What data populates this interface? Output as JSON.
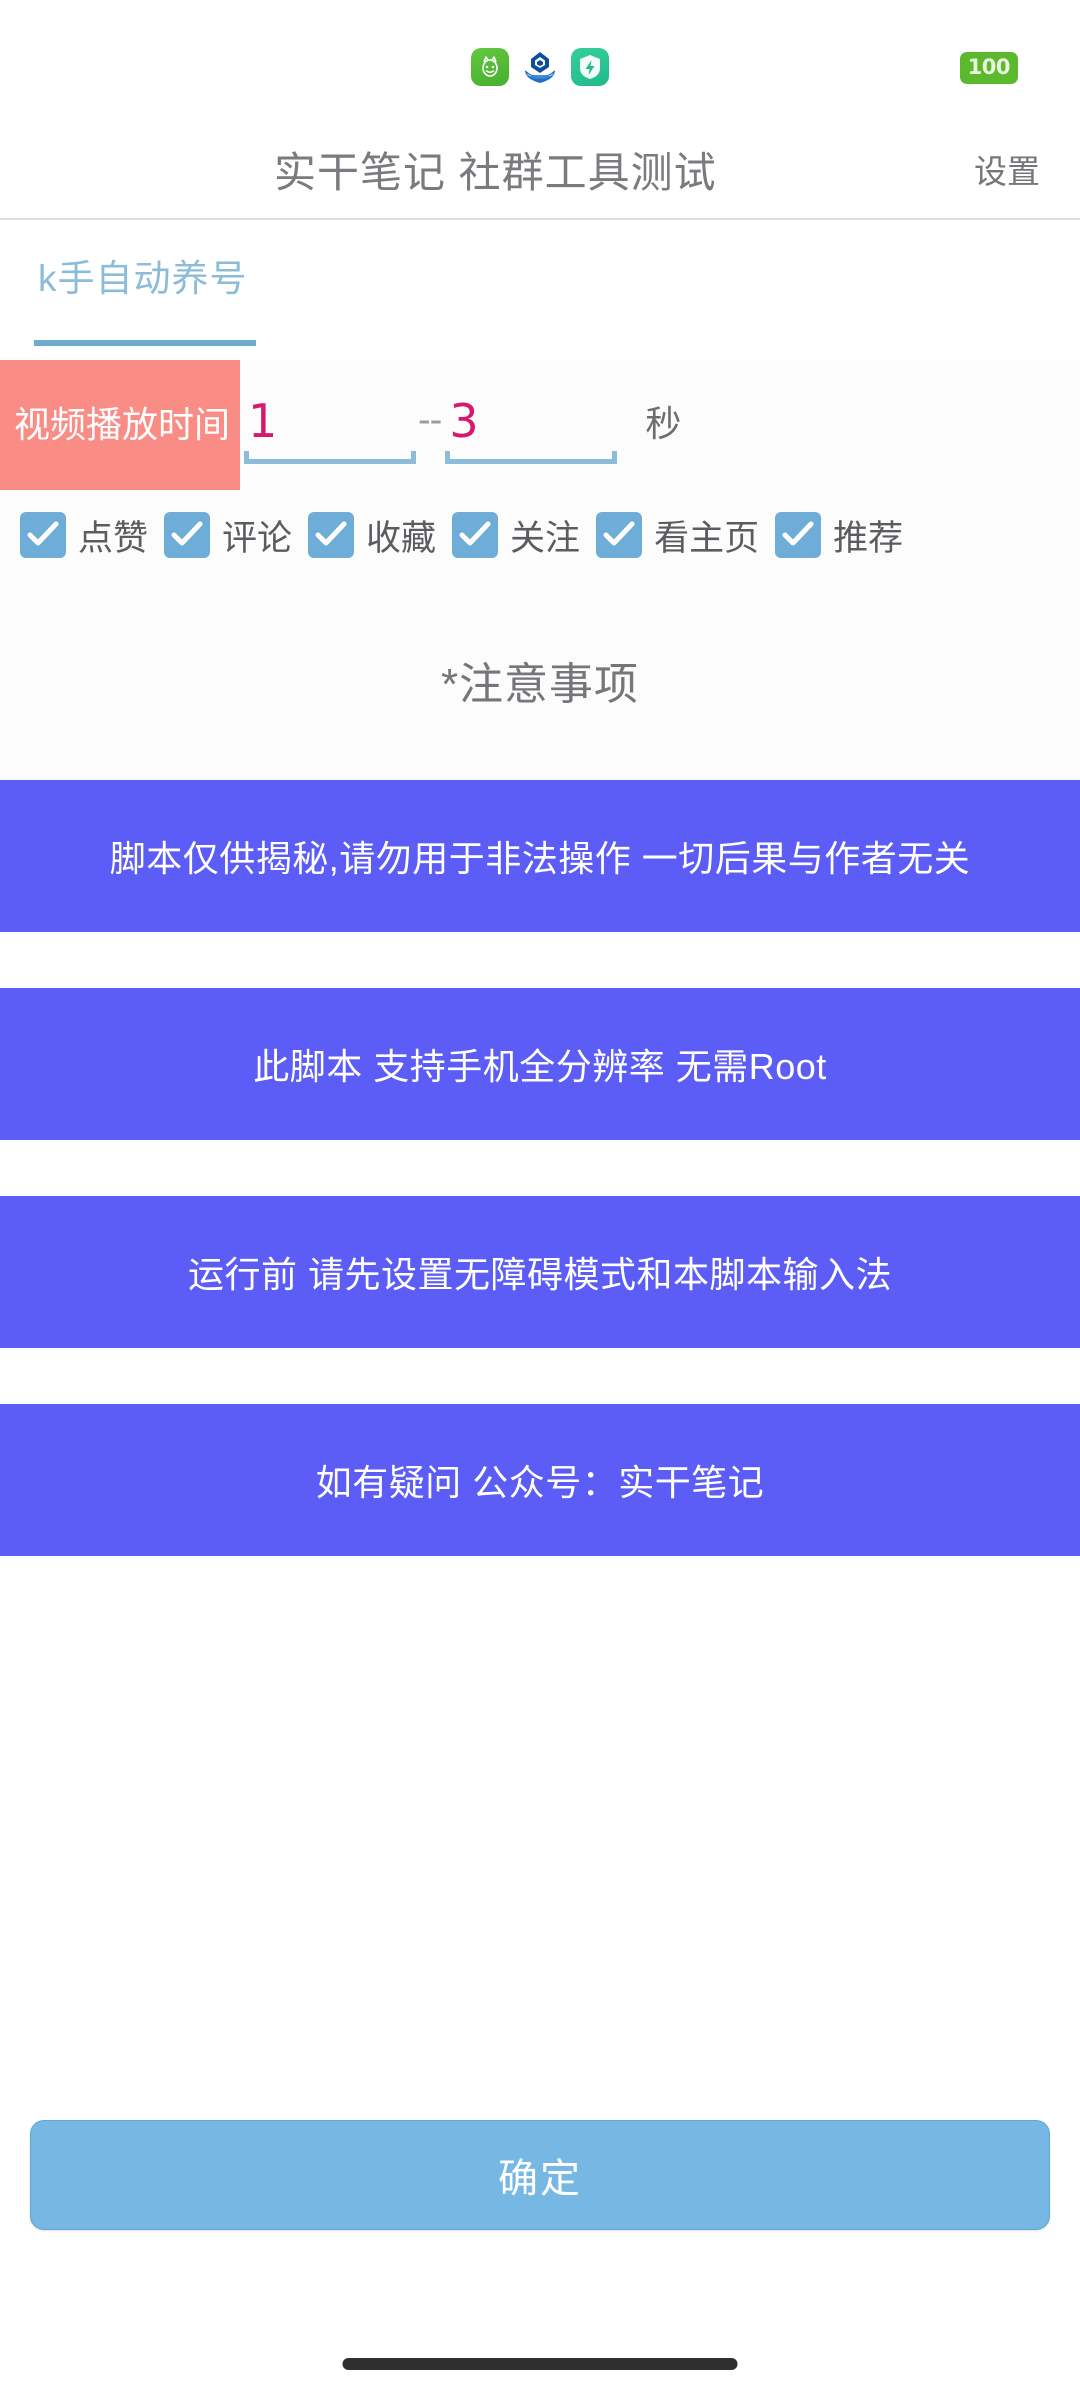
{
  "status_bar": {
    "app_icons": [
      {
        "name": "cat-face-icon",
        "color": "#55bf35"
      },
      {
        "name": "ccb-bank-icon",
        "color": "#1a5fa8"
      },
      {
        "name": "shield-bolt-icon",
        "color": "#2dc695"
      }
    ],
    "battery": {
      "label": "100",
      "bg_color": "#5cb82d",
      "text_color": "#e9f7dd"
    }
  },
  "header": {
    "title": "实干笔记 社群工具测试",
    "settings_label": "设置",
    "title_color": "#7b7b7f"
  },
  "tabs": [
    {
      "label": "k手自动养号",
      "active": true,
      "color": "#8cbcd8",
      "indicator_color": "#6fadd0"
    }
  ],
  "param_row": {
    "label": "视频播放时间",
    "label_bg": "#fa8c86",
    "min_value": "1",
    "max_value": "3",
    "separator": "--",
    "unit": "秒",
    "value_color": "#d6196e",
    "underline_color": "#8cbcd8"
  },
  "checkboxes": [
    {
      "label": "点赞",
      "checked": true
    },
    {
      "label": "评论",
      "checked": true
    },
    {
      "label": "收藏",
      "checked": true
    },
    {
      "label": "关注",
      "checked": true
    },
    {
      "label": "看主页",
      "checked": true
    },
    {
      "label": "推荐",
      "checked": true
    }
  ],
  "notice": {
    "title": "*注意事项",
    "banner_bg": "#5c5cf6",
    "items": [
      {
        "text": "脚本仅供揭秘,请勿用于非法操作 一切后果与作者无关"
      },
      {
        "text": "此脚本 支持手机全分辨率 无需Root"
      },
      {
        "text": "运行前 请先设置无障碍模式和本脚本输入法"
      },
      {
        "text": "如有疑问 公众号：实干笔记"
      }
    ]
  },
  "footer": {
    "confirm_label": "确定",
    "confirm_bg": "#76b8e3"
  }
}
